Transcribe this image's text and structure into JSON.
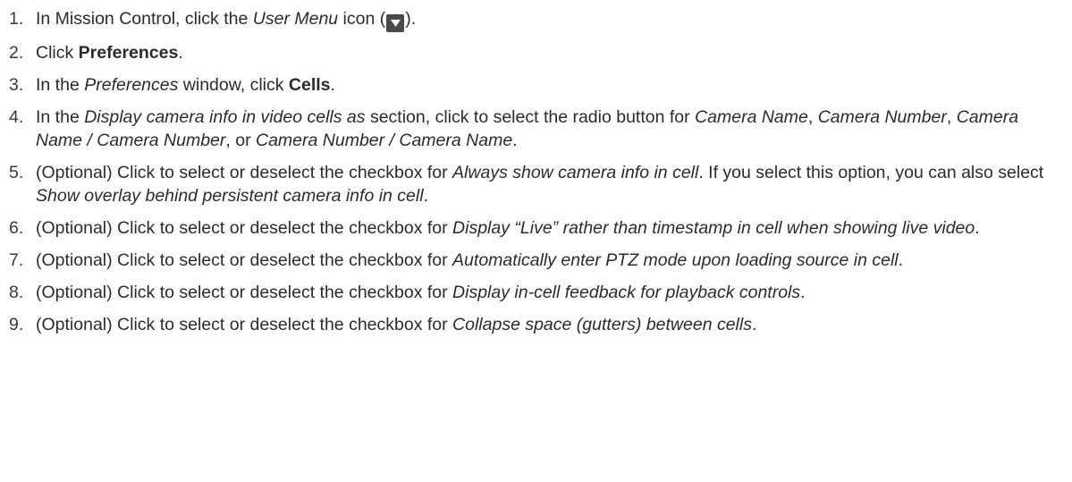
{
  "steps": [
    {
      "number": "1.",
      "before": "In Mission Control, click the ",
      "user_menu": "User Menu",
      "icon_label": " icon (",
      "icon": "chevron-down-icon",
      "after": ")."
    },
    {
      "number": "2.",
      "before": "Click ",
      "preferences": "Preferences",
      "after": "."
    },
    {
      "number": "3.",
      "before": "In the ",
      "preferences_window": "Preferences",
      "middle": " window, click ",
      "cells": "Cells",
      "after": "."
    },
    {
      "number": "4.",
      "before": "In the ",
      "section": "Display camera info in video cells as",
      "middle": " section, click to select the radio button for ",
      "opt1": "Camera Name",
      "sep1": ", ",
      "opt2": "Camera Number",
      "sep2": ", ",
      "opt3": "Camera Name / Camera Number",
      "sep3": ", or ",
      "opt4": "Camera Number / Camera Name",
      "after": "."
    },
    {
      "number": "5.",
      "before": "(Optional) Click to select or deselect the checkbox for ",
      "option": "Always show camera info in cell",
      "middle": ". If you select this option, you can also select ",
      "option2": "Show overlay behind persistent camera info in cell",
      "after": "."
    },
    {
      "number": "6.",
      "before": "(Optional) Click to select or deselect the checkbox for ",
      "option": "Display “Live” rather than timestamp in cell when showing live video",
      "after": "."
    },
    {
      "number": "7.",
      "before": "(Optional) Click to select or deselect the checkbox for ",
      "option": "Automatically enter PTZ mode upon loading source in cell",
      "after": "."
    },
    {
      "number": "8.",
      "before": "(Optional) Click to select or deselect the checkbox for ",
      "option": "Display in-cell feedback for playback controls",
      "after": "."
    },
    {
      "number": "9.",
      "before": "(Optional) Click to select or deselect the checkbox for ",
      "option": "Collapse space (gutters) between cells",
      "after": "."
    }
  ]
}
